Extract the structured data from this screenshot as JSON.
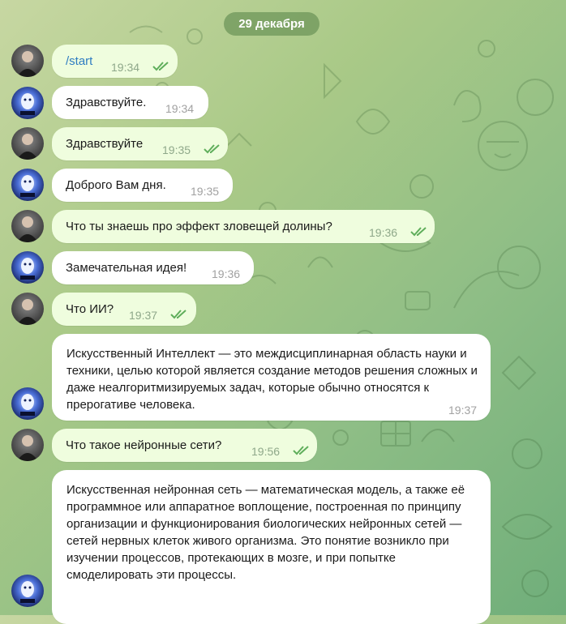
{
  "date_label": "29 декабря",
  "messages": [
    {
      "side": "out",
      "text": "/start",
      "time": "19:34",
      "read": true,
      "is_command": true
    },
    {
      "side": "in",
      "text": "Здравствуйте.",
      "time": "19:34"
    },
    {
      "side": "out",
      "text": "Здравствуйте",
      "time": "19:35",
      "read": true
    },
    {
      "side": "in",
      "text": "Доброго Вам дня.",
      "time": "19:35"
    },
    {
      "side": "out",
      "text": "Что ты знаешь про эффект зловещей долины?",
      "time": "19:36",
      "read": true
    },
    {
      "side": "in",
      "text": "Замечательная идея!",
      "time": "19:36"
    },
    {
      "side": "out",
      "text": "Что ИИ?",
      "time": "19:37",
      "read": true
    },
    {
      "side": "in",
      "text": "Искусственный Интеллект — это междисциплинарная область науки и техники, целью которой является создание методов решения сложных и даже неалгоритмизируемых задач, которые обычно относятся к прерогативе человека.",
      "time": "19:37"
    },
    {
      "side": "out",
      "text": "Что такое нейронные сети?",
      "time": "19:56",
      "read": true
    },
    {
      "side": "in",
      "text": "Искусственная нейронная сеть — математическая модель, а также её программное или аппаратное воплощение, построенная по принципу организации и функционирования биологических нейронных сетей — сетей нервных клеток живого организма. Это понятие возникло при изучении процессов, протекающих в мозге, и при попытке смоделировать эти процессы.",
      "time": ""
    }
  ],
  "colors": {
    "outgoing_bubble": "#effdde",
    "incoming_bubble": "#ffffff",
    "read_checks": "#5fae5b",
    "command_link": "#2f7dc2"
  }
}
